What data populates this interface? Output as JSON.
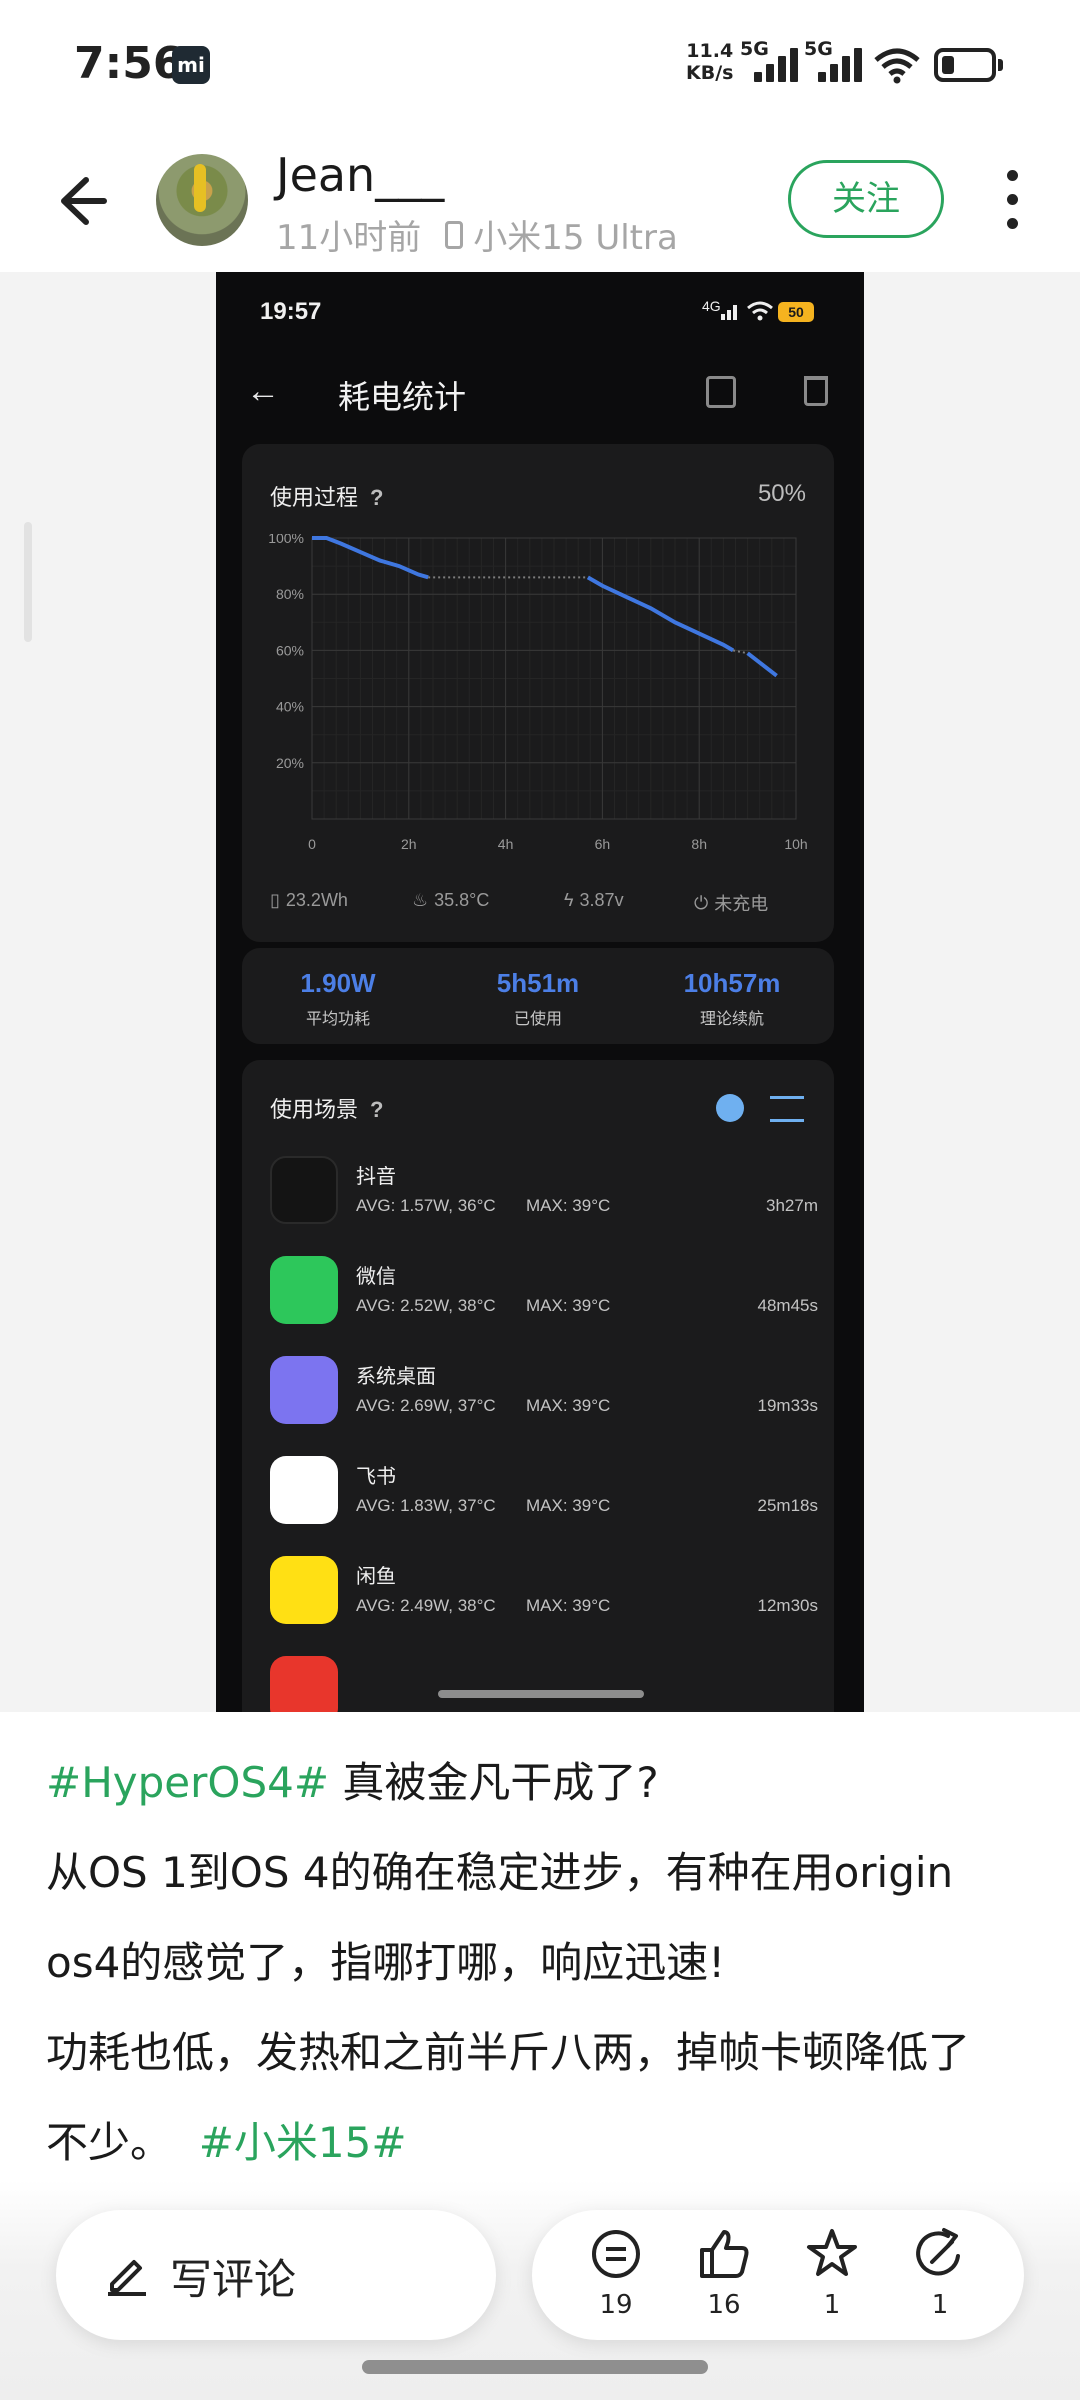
{
  "status_bar": {
    "time": "7:56",
    "mi_badge": "mi",
    "net_speed": "11.4",
    "net_unit": "KB/s",
    "sim1": "5G",
    "sim2": "5G"
  },
  "post_header": {
    "author": "Jean___",
    "time_ago": "11小时前",
    "device": "小米15 Ultra",
    "follow_label": "关注"
  },
  "screenshot": {
    "status_time": "19:57",
    "status_net": "4G",
    "battery_level": "50",
    "title": "耗电统计",
    "usage": {
      "title": "使用过程",
      "qmark": "?",
      "percent": "50%",
      "metrics": {
        "energy": "23.2Wh",
        "temp": "35.8°C",
        "voltage": "3.87v",
        "charging": "未充电"
      }
    },
    "summary": [
      {
        "value": "1.90W",
        "label": "平均功耗"
      },
      {
        "value": "5h51m",
        "label": "已使用"
      },
      {
        "value": "10h57m",
        "label": "理论续航"
      }
    ],
    "scenes": {
      "title": "使用场景",
      "qmark": "?",
      "apps": [
        {
          "name": "抖音",
          "avg": "AVG: 1.57W, 36°C",
          "max": "MAX:  39°C",
          "duration": "3h27m",
          "color": "#141414"
        },
        {
          "name": "微信",
          "avg": "AVG: 2.52W, 38°C",
          "max": "MAX:  39°C",
          "duration": "48m45s",
          "color": "#2dc75b"
        },
        {
          "name": "系统桌面",
          "avg": "AVG: 2.69W, 37°C",
          "max": "MAX:  39°C",
          "duration": "19m33s",
          "color": "#7c74f0"
        },
        {
          "name": "飞书",
          "avg": "AVG: 1.83W, 37°C",
          "max": "MAX:  39°C",
          "duration": "25m18s",
          "color": "#ffffff"
        },
        {
          "name": "闲鱼",
          "avg": "AVG: 2.49W, 38°C",
          "max": "MAX:  39°C",
          "duration": "12m30s",
          "color": "#ffe014"
        }
      ]
    }
  },
  "chart_data": {
    "type": "line",
    "title": "使用过程",
    "x_ticks": [
      "0",
      "2h",
      "4h",
      "6h",
      "8h",
      "10h"
    ],
    "y_ticks": [
      "20%",
      "40%",
      "60%",
      "80%",
      "100%"
    ],
    "xlim": [
      0,
      10
    ],
    "ylim": [
      0,
      100
    ],
    "series": [
      {
        "x": [
          0,
          0.3,
          0.6,
          1.0,
          1.4,
          1.8,
          2.2,
          2.4
        ],
        "y": [
          100,
          100,
          98,
          95,
          92,
          90,
          87,
          86
        ],
        "color": "#3f77e0",
        "style": "solid"
      },
      {
        "x": [
          2.4,
          5.7
        ],
        "y": [
          86,
          86
        ],
        "color": "#7d7d7d",
        "style": "dotted"
      },
      {
        "x": [
          5.7,
          6.0,
          6.5,
          7.0,
          7.5,
          8.0,
          8.5,
          8.7
        ],
        "y": [
          86,
          83,
          79,
          75,
          70,
          66,
          62,
          60
        ],
        "color": "#3f77e0",
        "style": "solid"
      },
      {
        "x": [
          8.7,
          9.0
        ],
        "y": [
          60,
          59
        ],
        "color": "#7d7d7d",
        "style": "dotted"
      },
      {
        "x": [
          9.0,
          9.3,
          9.6
        ],
        "y": [
          59,
          55,
          51
        ],
        "color": "#3f77e0",
        "style": "solid"
      }
    ]
  },
  "post": {
    "hashtag1": "#HyperOS4#",
    "line1": " 真被金凡干成了?",
    "line2": "从OS 1到OS 4的确在稳定进步，有种在用origin",
    "line3": "os4的感觉了，指哪打哪，响应迅速!",
    "line4": "功耗也低，发热和之前半斤八两，掉帧卡顿降低了",
    "line5": "不少。",
    "hashtag2": "#小米15#"
  },
  "bottom_bar": {
    "comment_label": "写评论",
    "comments": "19",
    "likes": "16",
    "stars": "1",
    "shares": "1"
  }
}
